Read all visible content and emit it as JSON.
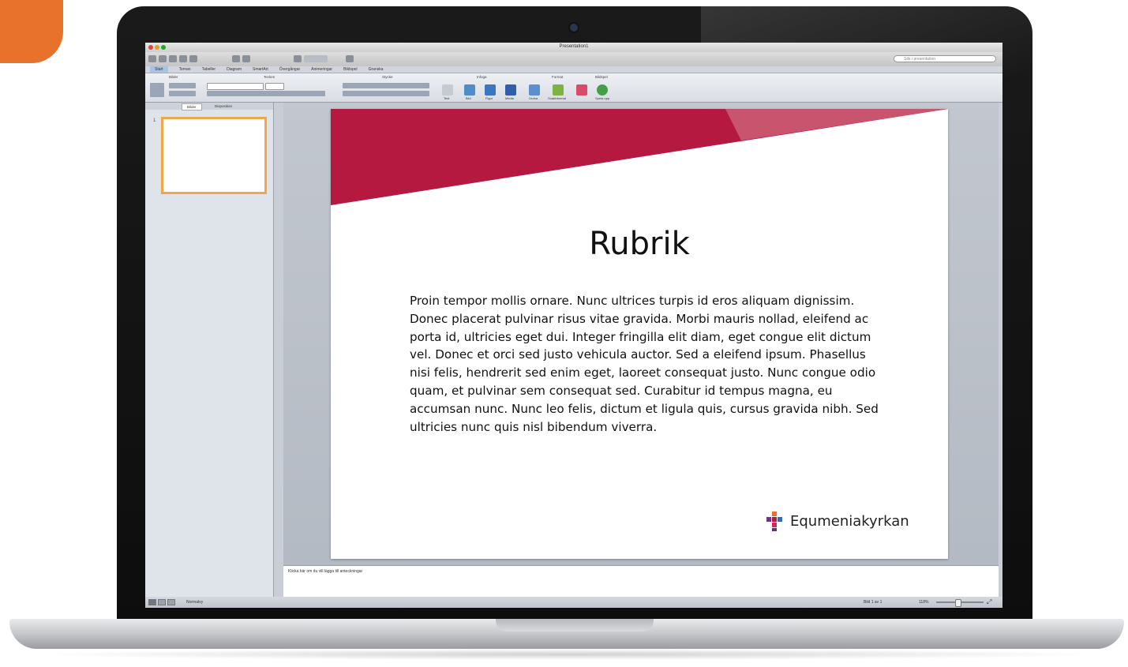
{
  "window": {
    "title": "Presentation1"
  },
  "toolbar": {
    "search_placeholder": "Sök i presentation"
  },
  "ribbon": {
    "tabs": [
      "Start",
      "Teman",
      "Tabeller",
      "Diagram",
      "SmartArt",
      "Övergångar",
      "Animeringar",
      "Bildspel",
      "Granska"
    ],
    "groups": [
      "Bilder",
      "Tecken",
      "Stycke",
      "Infoga",
      "Format",
      "Bildspel"
    ],
    "tools": [
      "Text",
      "Bild",
      "Figur",
      "Media",
      "Ordna",
      "Snabbformat",
      "Spela upp"
    ]
  },
  "slides_pane": {
    "tabs": [
      "Bilder",
      "Disposition"
    ],
    "slide_number": "1"
  },
  "slide": {
    "title": "Rubrik",
    "body": "Proin tempor mollis ornare. Nunc ultrices turpis id eros aliquam dignissim. Donec placerat pulvinar risus vitae gravida. Morbi mauris nollad, eleifend ac porta id, ultricies eget dui. Integer fringilla elit diam, eget congue elit dictum vel. Donec et orci sed justo vehicula auctor. Sed a eleifend ipsum. Phasellus nisi felis, hendrerit sed enim eget, laoreet consequat justo. Nunc congue odio quam, et pulvinar sem consequat sed. Curabitur id tempus magna, eu accumsan nunc. Nunc leo felis, dictum et ligula quis, cursus gravida nibh. Sed ultricies nunc quis nisl bibendum viverra.",
    "logo_text": "Equmeniakyrkan",
    "accent_color": "#b5193f",
    "accent_light_color": "#c9546e"
  },
  "notes": {
    "placeholder": "Klicka här om du vill lägga till anteckningar"
  },
  "statusbar": {
    "view_label": "Normalvy",
    "slide_counter": "Bild 1 av 1",
    "zoom": "118%"
  }
}
